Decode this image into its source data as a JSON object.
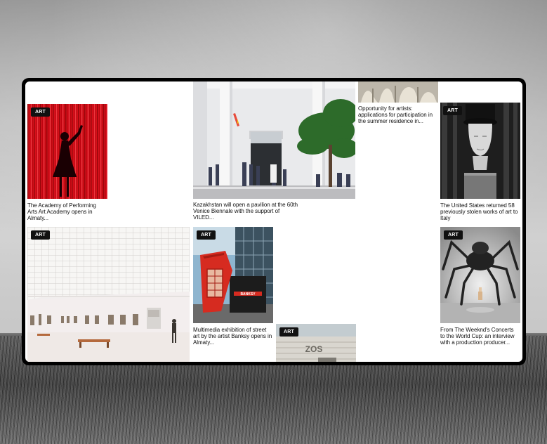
{
  "badge_label": "ART",
  "cards": [
    {
      "caption": "The Academy of Performing Arts Art Academy opens in Almaty..."
    },
    {
      "caption": "Kazakhstan will open a pavilion at the 60th Venice Biennale with the support of VILED..."
    },
    {
      "caption": "Opportunity for artists: applications for participation in the summer residence in..."
    },
    {
      "caption": "The United States returned 58 previously stolen works of art to Italy"
    },
    {
      "caption": ""
    },
    {
      "caption": "Multimedia exhibition of street art by the artist Banksy opens in Almaty..."
    },
    {
      "caption": ""
    },
    {
      "caption": "From The Weeknd's Concerts to the World Cup: an interview with a production producer..."
    }
  ],
  "colors": {
    "window_border": "#000000",
    "badge_bg": "#111111",
    "banksy_booth": "#d62b20",
    "curtain_red": "#e0131b"
  },
  "banksy_sign": "BANKSY",
  "building_sign": "ZOS"
}
